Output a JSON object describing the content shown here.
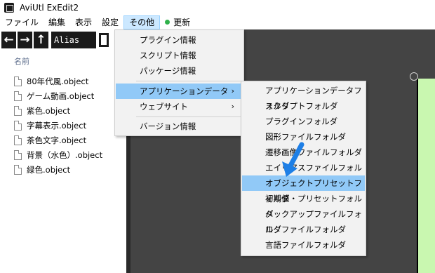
{
  "window": {
    "title": "AviUtl ExEdit2"
  },
  "menubar": {
    "items": [
      {
        "label": "ファイル"
      },
      {
        "label": "編集"
      },
      {
        "label": "表示"
      },
      {
        "label": "設定"
      },
      {
        "label": "その他"
      },
      {
        "label": "更新"
      }
    ]
  },
  "toolbar": {
    "back": "←",
    "forward": "→",
    "up": "↑",
    "alias_label": "Alias"
  },
  "file_panel": {
    "header": "名前",
    "files": [
      "80年代風.object",
      "ゲーム動画.object",
      "紫色.object",
      "字幕表示.object",
      "茶色文字.object",
      "背景（水色）.object",
      "緑色.object"
    ]
  },
  "other_menu": {
    "items": [
      {
        "label": "プラグイン情報"
      },
      {
        "label": "スクリプト情報"
      },
      {
        "label": "パッケージ情報"
      },
      {
        "label": "アプリケーションデータ",
        "submenu_arrow": "›"
      },
      {
        "label": "ウェブサイト",
        "submenu_arrow": "›"
      },
      {
        "label": "バージョン情報"
      }
    ]
  },
  "app_data_menu": {
    "items": [
      "アプリケーションデータフォルダ",
      "スクリプトフォルダ",
      "プラグインフォルダ",
      "図形ファイルフォルダ",
      "遷移画像ファイルフォルダ",
      "エイリアスファイルフォルダ",
      "オブジェクトプリセットフォルダ",
      "初期値・プリセットフォルダ",
      "バックアップファイルフォルダ",
      "ログファイルフォルダ",
      "言語ファイルフォルダ"
    ],
    "selected_index": 6
  },
  "colors": {
    "menu_highlight": "#91c9f7",
    "menubar_active": "#cce8ff",
    "update_dot": "#2fb14a",
    "pointer_arrow": "#1e7fe6",
    "canvas": "#444444",
    "object_fill": "#c9f7b0"
  },
  "icons": {
    "update": "green-dot-icon",
    "file": "document-icon",
    "pointer": "blue-arrow-icon"
  }
}
